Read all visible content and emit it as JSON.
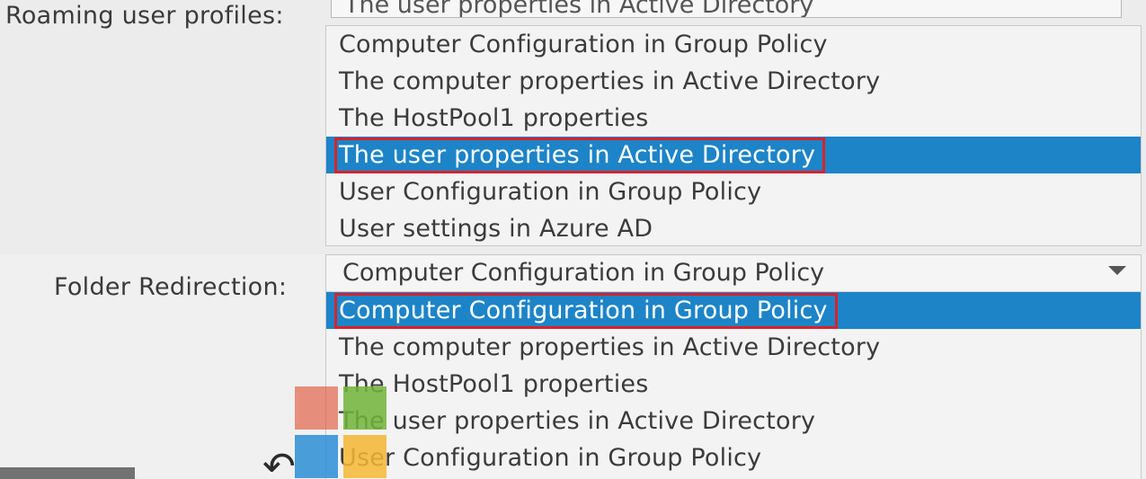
{
  "roaming": {
    "label": "Roaming user profiles:",
    "current_value": "The user properties in Active Directory",
    "options": [
      "Computer Configuration in Group Policy",
      "The computer properties in Active Directory",
      "The HostPool1 properties",
      "The user properties in Active Directory",
      "User Configuration in Group Policy",
      "User settings in Azure AD"
    ],
    "selected_index": 3
  },
  "folder": {
    "label": "Folder Redirection:",
    "current_value": "Computer Configuration in Group Policy",
    "options": [
      "Computer Configuration in Group Policy",
      "The computer properties in Active Directory",
      "The HostPool1 properties",
      "The user properties in Active Directory",
      "User Configuration in Group Policy"
    ],
    "selected_index": 0
  },
  "icons": {
    "dropdown_arrow": "chevron-down-icon",
    "logo": "microsoft-logo-icon",
    "back": "back-arrow-icon"
  },
  "colors": {
    "selection": "#1d84c8",
    "highlight_box": "#d8222a"
  }
}
